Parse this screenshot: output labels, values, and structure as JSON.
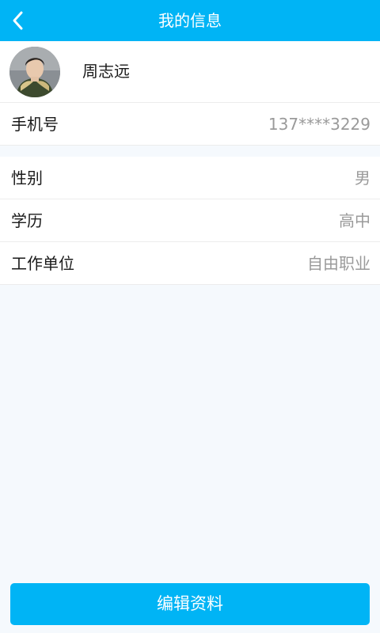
{
  "header": {
    "title": "我的信息",
    "back_icon": "chevron-left-icon"
  },
  "profile": {
    "name": "周志远",
    "avatar_icon": "user-avatar"
  },
  "rows": [
    {
      "label": "手机号",
      "value": "137****3229"
    },
    {
      "label": "性别",
      "value": "男"
    },
    {
      "label": "学历",
      "value": "高中"
    },
    {
      "label": "工作单位",
      "value": "自由职业"
    }
  ],
  "footer": {
    "edit_label": "编辑资料"
  },
  "colors": {
    "accent": "#00b4f5",
    "background": "#f5f9fd",
    "value_text": "#9a9a9a"
  }
}
